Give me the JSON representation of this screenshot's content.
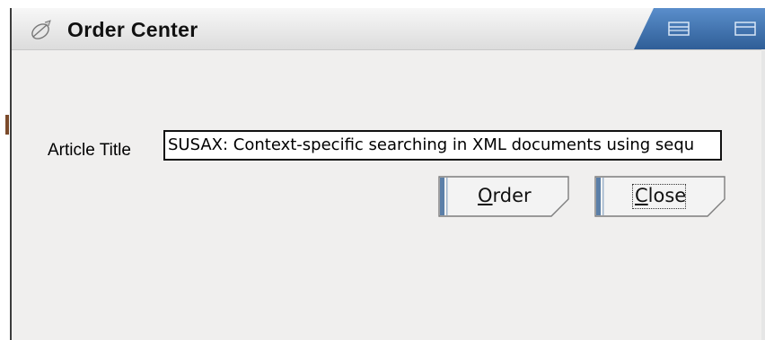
{
  "window": {
    "title": "Order Center",
    "accent_color": "#3a6fa8"
  },
  "form": {
    "article_title_label": "Article Title",
    "article_title_value": "SUSAX: Context-specific searching in XML documents using sequ"
  },
  "buttons": {
    "order_mnemonic": "O",
    "order_rest": "rder",
    "close_mnemonic": "C",
    "close_rest": "lose"
  },
  "icons": {
    "app": "leaf-icon",
    "minimize": "minimize-icon",
    "maximize": "maximize-icon"
  }
}
